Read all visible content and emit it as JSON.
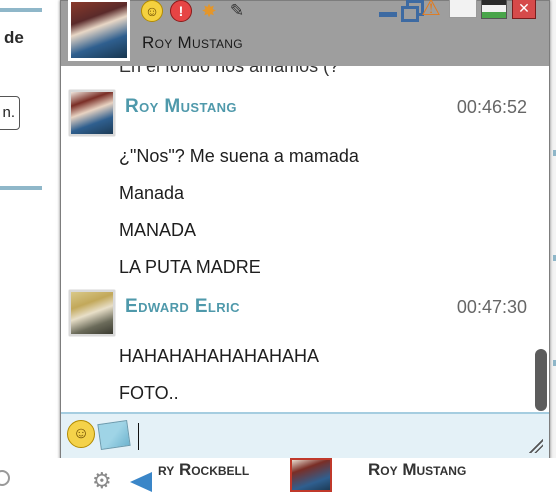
{
  "background": {
    "left_fragment_text": "de",
    "left_button_text": "n.",
    "accent_color": "#8fb7c9"
  },
  "chat_window": {
    "header": {
      "contact_name": "Roy Mustang",
      "icons": [
        "smiley-icon",
        "alert-icon",
        "effects-icon",
        "pen-icon",
        "minimize-icon",
        "restore-icon",
        "warning-icon",
        "mail-icon",
        "print-icon",
        "close-icon"
      ]
    },
    "partial_top_line": "En el fondo nos amamos (?",
    "messages": [
      {
        "sender": "Roy Mustang",
        "time": "00:46:52",
        "lines": [
          "¿\"Nos\"? Me suena a mamada",
          "Manada",
          "MANADA",
          "LA PUTA MADRE"
        ]
      },
      {
        "sender": "Edward Elric",
        "time": "00:47:30",
        "lines": [
          "HAHAHAHAHAHAHAHA",
          "FOTO.."
        ]
      }
    ],
    "input": {
      "value": "",
      "placeholder": ""
    },
    "colors": {
      "sender": "#4f99ab",
      "header_bg": "#9e9e9e",
      "input_bg": "#e4f1f7"
    }
  },
  "taskbar": {
    "items": [
      {
        "label": "ry Rockbell"
      },
      {
        "label": "Roy Mustang"
      }
    ]
  }
}
